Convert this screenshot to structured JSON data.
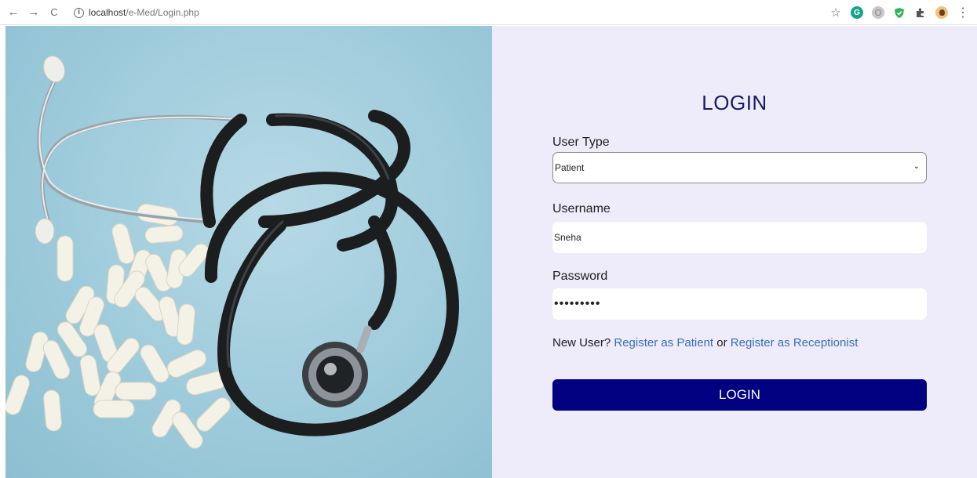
{
  "browser": {
    "back_icon": "←",
    "forward_icon": "→",
    "reload_icon": "C",
    "url_host": "localhost",
    "url_path": "/e-Med/Login.php",
    "star_icon": "☆",
    "kebab_icon": "⋮",
    "grammarly_icon": "G"
  },
  "login": {
    "heading": "LOGIN",
    "user_type_label": "User Type",
    "user_type_value": "Patient",
    "username_label": "Username",
    "username_value": "Sneha",
    "password_label": "Password",
    "password_value": "•••••••••",
    "new_user_text": "New User?",
    "register_patient_link": "Register as Patient",
    "or_text": "or",
    "register_receptionist_link": "Register as Receptionist",
    "button_label": "LOGIN"
  },
  "colors": {
    "panel_bg": "#eeebfb",
    "heading": "#1a1a66",
    "link": "#3a6fb0",
    "button_bg": "#000080"
  }
}
